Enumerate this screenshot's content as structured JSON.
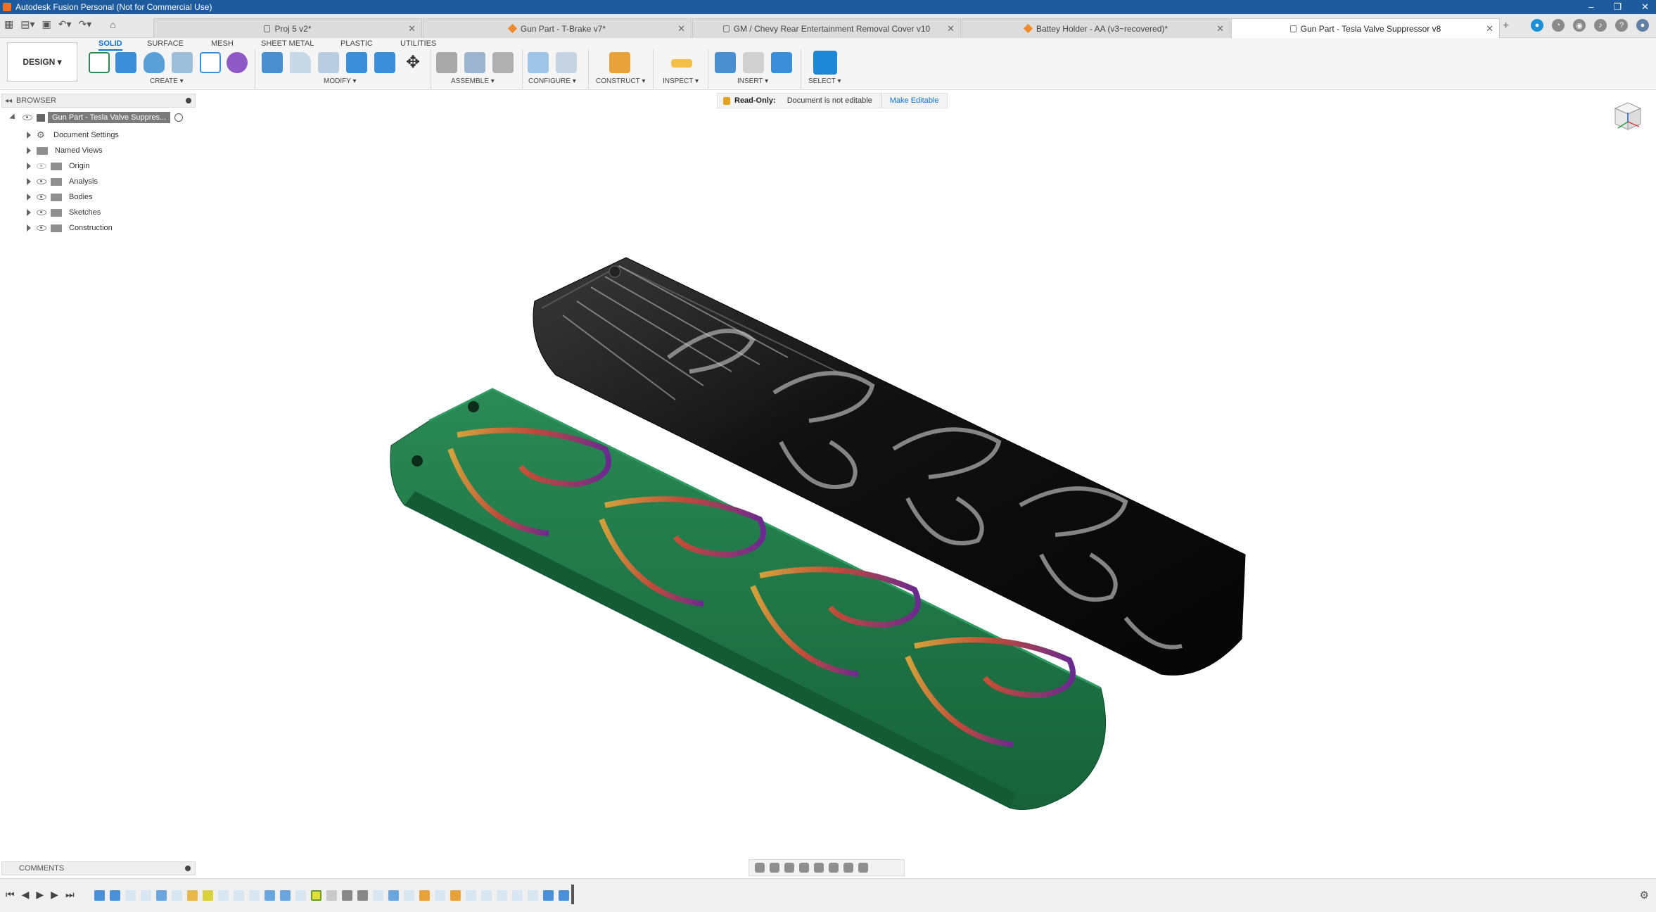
{
  "window": {
    "title": "Autodesk Fusion Personal (Not for Commercial Use)"
  },
  "tabs": [
    {
      "label": "Proj 5 v2*",
      "icon": "lock-icon"
    },
    {
      "label": "Gun Part - T-Brake v7*",
      "icon": "part-icon"
    },
    {
      "label": "GM / Chevy Rear Entertainment Removal Cover v10",
      "icon": "lock-icon"
    },
    {
      "label": "Battey Holder - AA (v3~recovered)*",
      "icon": "part-icon"
    },
    {
      "label": "Gun Part - Tesla Valve Suppressor v8",
      "icon": "lock-icon",
      "active": true
    }
  ],
  "toolbar": {
    "workspace": "DESIGN",
    "workspace_tabs": [
      "SOLID",
      "SURFACE",
      "MESH",
      "SHEET METAL",
      "PLASTIC",
      "UTILITIES"
    ],
    "groups": [
      "CREATE",
      "MODIFY",
      "ASSEMBLE",
      "CONFIGURE",
      "CONSTRUCT",
      "INSPECT",
      "INSERT",
      "SELECT"
    ]
  },
  "banner": {
    "title": "Read-Only:",
    "message": "Document is not editable",
    "action": "Make Editable"
  },
  "browser": {
    "title": "BROWSER",
    "root": "Gun Part - Tesla Valve Suppres...",
    "items": [
      {
        "label": "Document Settings",
        "icon": "gear-icon",
        "eye": false
      },
      {
        "label": "Named Views",
        "icon": "folder-icon",
        "eye": false
      },
      {
        "label": "Origin",
        "icon": "folder-icon",
        "eye": true
      },
      {
        "label": "Analysis",
        "icon": "folder-icon",
        "eye": true
      },
      {
        "label": "Bodies",
        "icon": "folder-icon",
        "eye": true
      },
      {
        "label": "Sketches",
        "icon": "folder-icon",
        "eye": true
      },
      {
        "label": "Construction",
        "icon": "folder-icon",
        "eye": true
      }
    ]
  },
  "comments": {
    "title": "COMMENTS"
  },
  "colors": {
    "titlebar": "#1e5a9e",
    "accent": "#0a6fd6",
    "green_body": "#1f7a4a",
    "black_body": "#111111"
  }
}
